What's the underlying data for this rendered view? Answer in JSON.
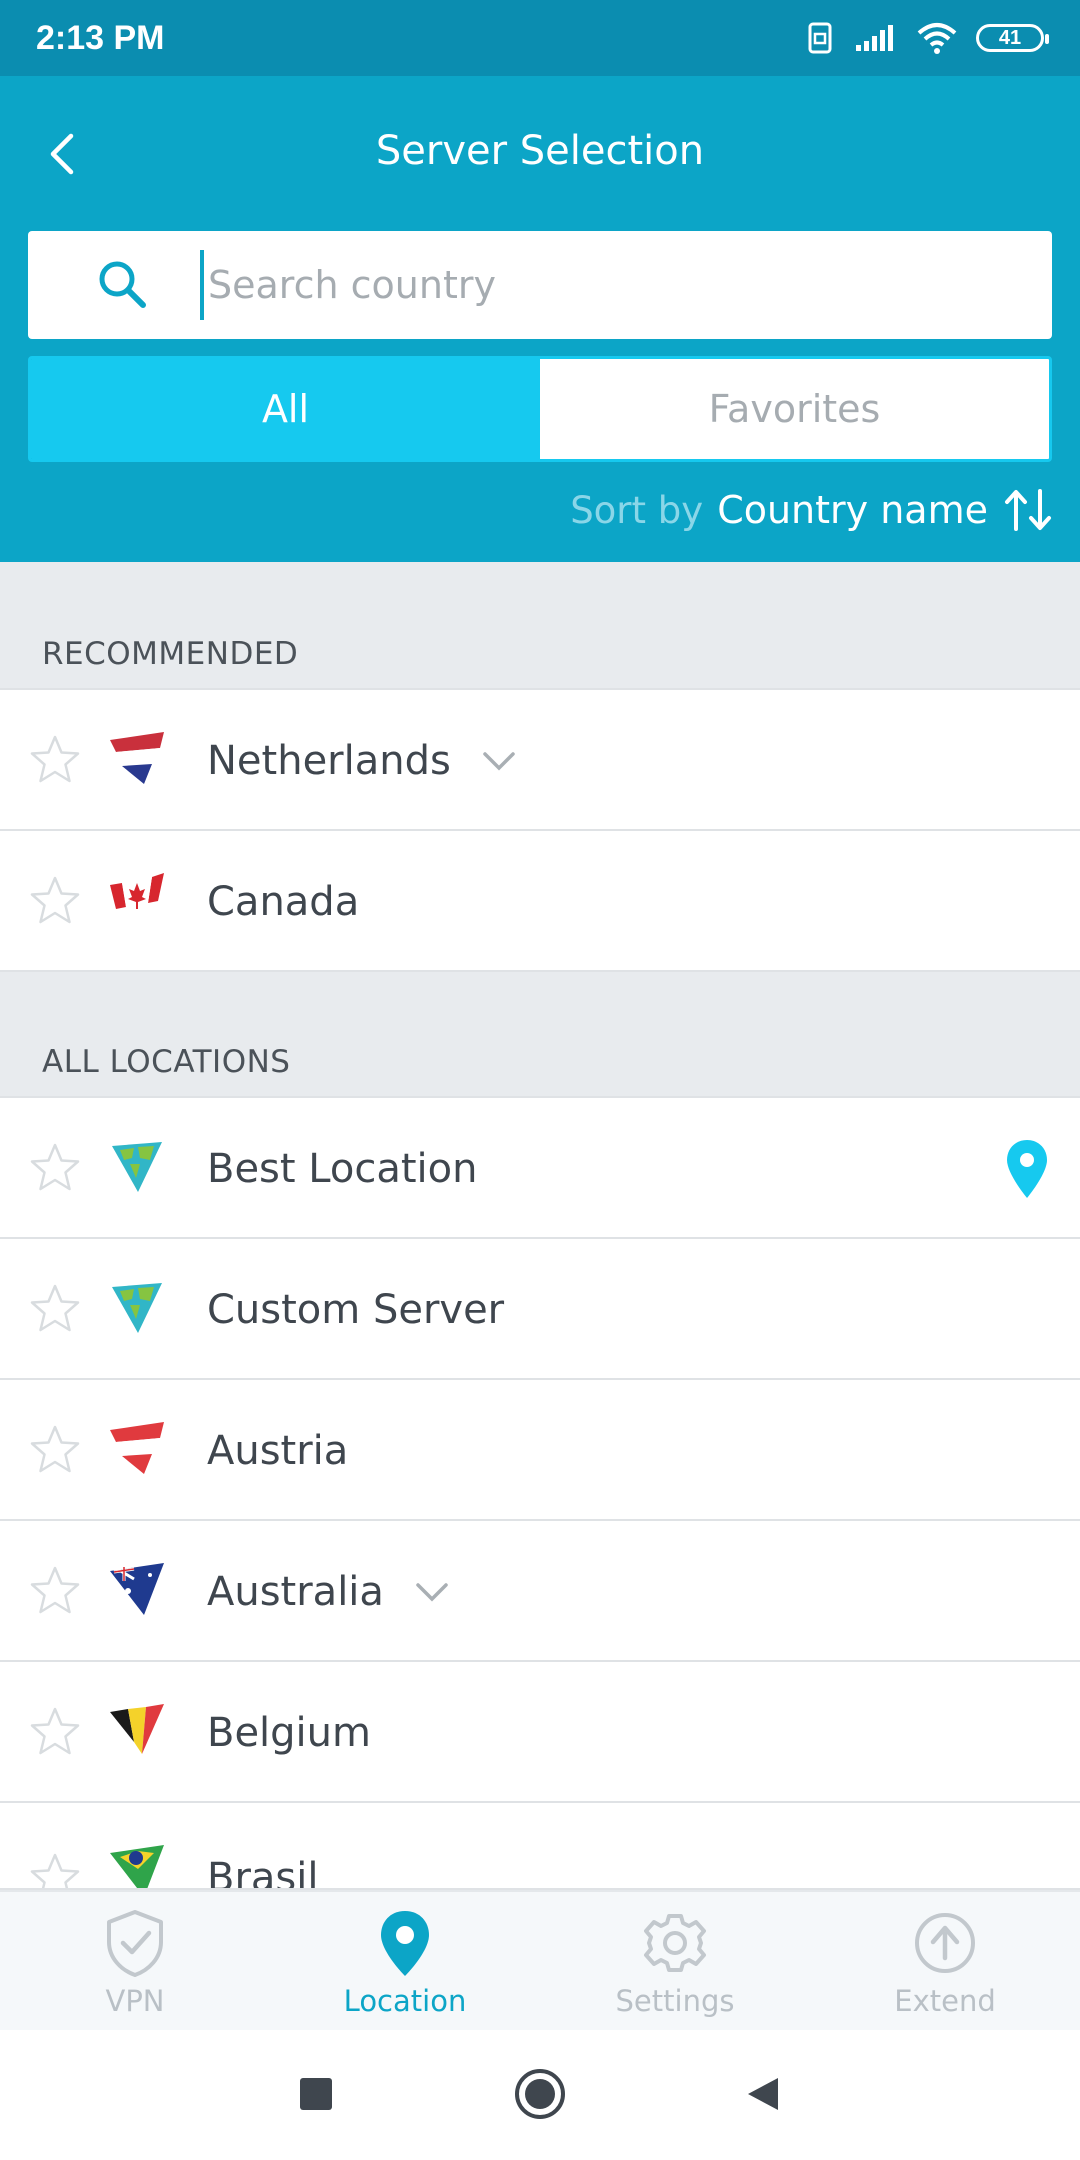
{
  "status_bar": {
    "time": "2:13 PM",
    "battery": "41"
  },
  "header": {
    "title": "Server Selection",
    "search_placeholder": "Search country",
    "tabs": [
      {
        "label": "All",
        "active": true
      },
      {
        "label": "Favorites",
        "active": false
      }
    ],
    "sort_label": "Sort by",
    "sort_value": "Country name"
  },
  "sections": {
    "recommended": "RECOMMENDED",
    "all_locations": "ALL LOCATIONS"
  },
  "recommended": [
    {
      "name": "Netherlands",
      "flag": "netherlands",
      "expandable": true
    },
    {
      "name": "Canada",
      "flag": "canada",
      "expandable": false
    }
  ],
  "locations": [
    {
      "name": "Best Location",
      "flag": "world-map",
      "selected": true
    },
    {
      "name": "Custom Server",
      "flag": "world-map"
    },
    {
      "name": "Austria",
      "flag": "austria"
    },
    {
      "name": "Australia",
      "flag": "australia",
      "expandable": true
    },
    {
      "name": "Belgium",
      "flag": "belgium"
    },
    {
      "name": "Brasil",
      "flag": "brazil"
    }
  ],
  "bottom_nav": [
    {
      "label": "VPN",
      "icon": "shield-check-icon",
      "active": false
    },
    {
      "label": "Location",
      "icon": "location-pin-icon",
      "active": true
    },
    {
      "label": "Settings",
      "icon": "gear-icon",
      "active": false
    },
    {
      "label": "Extend",
      "icon": "upload-arrow-icon",
      "active": false
    }
  ],
  "colors": {
    "header": "#0ca5c7",
    "accent": "#16c9ef",
    "status_bar": "#0b8db0"
  }
}
